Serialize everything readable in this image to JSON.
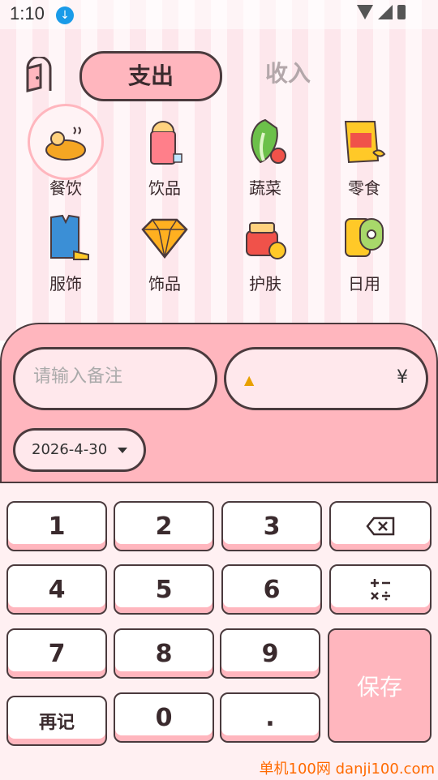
{
  "status": {
    "time": "1:10"
  },
  "tabs": {
    "expense": "支出",
    "income": "收入"
  },
  "categories": [
    {
      "label": "餐饮",
      "icon": "meal-icon"
    },
    {
      "label": "饮品",
      "icon": "drink-icon"
    },
    {
      "label": "蔬菜",
      "icon": "vegetable-icon"
    },
    {
      "label": "零食",
      "icon": "snack-icon"
    },
    {
      "label": "服饰",
      "icon": "clothes-icon"
    },
    {
      "label": "饰品",
      "icon": "jewelry-icon"
    },
    {
      "label": "护肤",
      "icon": "skincare-icon"
    },
    {
      "label": "日用",
      "icon": "daily-use-icon"
    }
  ],
  "input": {
    "note_placeholder": "请输入备注",
    "currency": "¥",
    "date": "2026-4-30"
  },
  "keys": [
    "1",
    "2",
    "3",
    "4",
    "5",
    "6",
    "7",
    "8",
    "9",
    "再记",
    "0",
    "."
  ],
  "save_label": "保存",
  "watermark": "单机100网 danji100.com",
  "colors": {
    "accent": "#ffb6be",
    "outline": "#4a3a3d"
  }
}
